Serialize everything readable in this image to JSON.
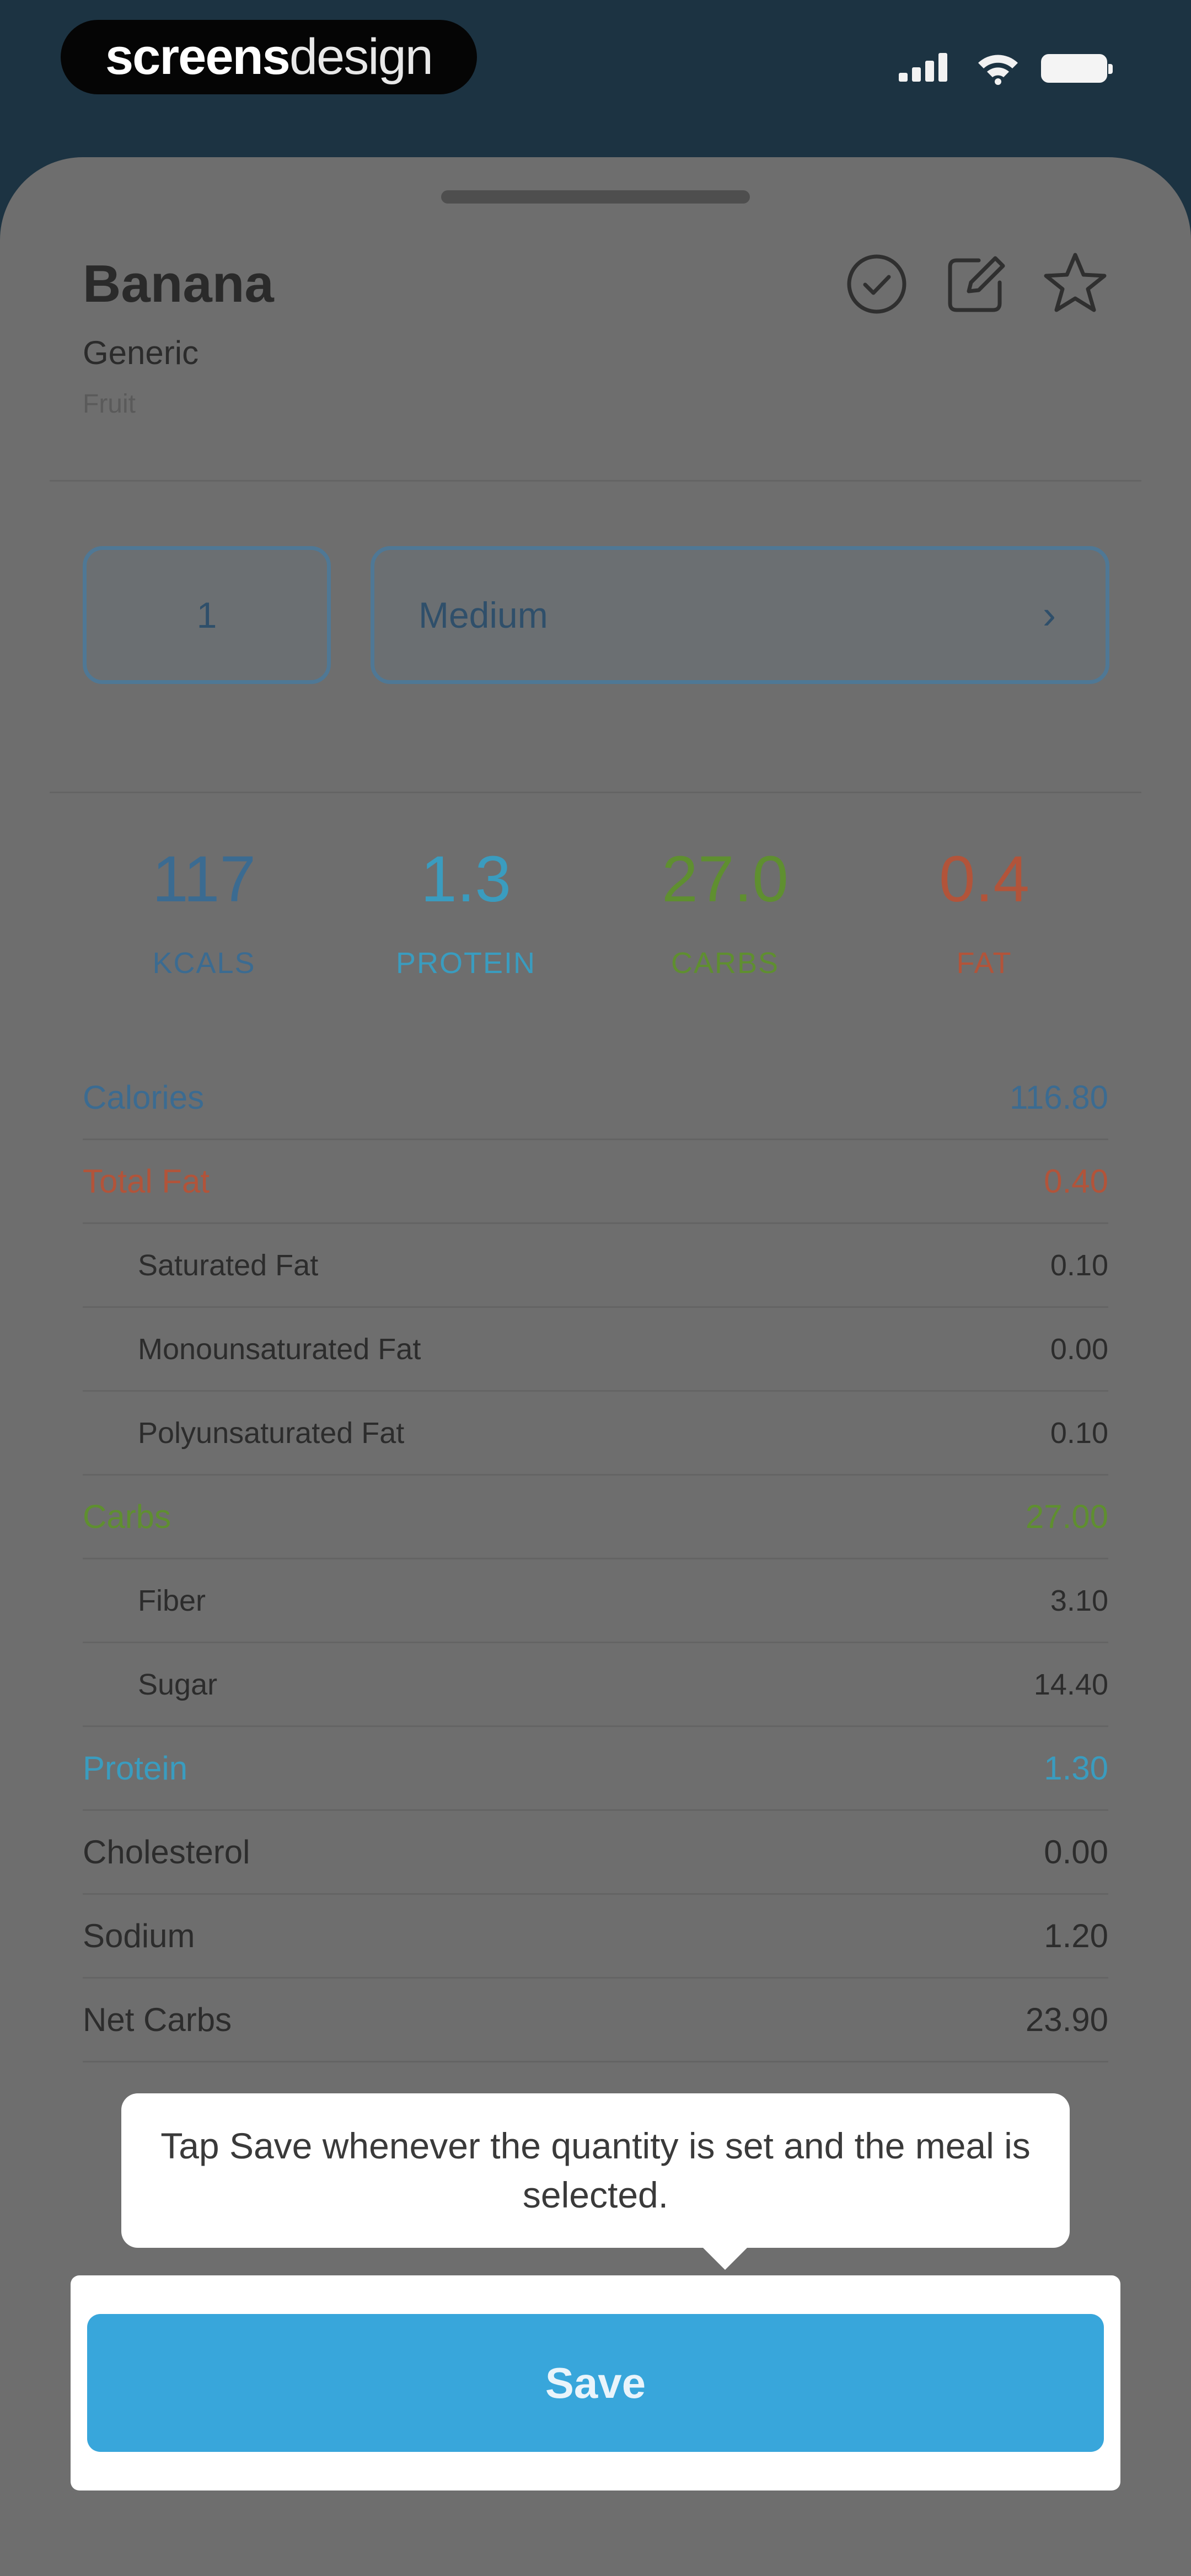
{
  "status_bar": {
    "brand_bold": "screens",
    "brand_light": "design"
  },
  "food": {
    "name": "Banana",
    "brand": "Generic",
    "category": "Fruit"
  },
  "actions": [
    "check-circle-icon",
    "edit-icon",
    "star-icon"
  ],
  "serving": {
    "quantity": "1",
    "size": "Medium",
    "chevron": "›"
  },
  "macros": [
    {
      "value": "117",
      "label": "KCALS",
      "color": "#3b6b91"
    },
    {
      "value": "1.3",
      "label": "PROTEIN",
      "color": "#3a9cbf"
    },
    {
      "value": "27.0",
      "label": "CARBS",
      "color": "#5f8f30"
    },
    {
      "value": "0.4",
      "label": "FAT",
      "color": "#b2543a"
    }
  ],
  "nutrients": [
    {
      "name": "Calories",
      "value": "116.80",
      "color": "#3b6b91",
      "sub": false
    },
    {
      "name": "Total Fat",
      "value": "0.40",
      "color": "#b2543a",
      "sub": false
    },
    {
      "name": "Saturated Fat",
      "value": "0.10",
      "color": "#2c2c2c",
      "sub": true
    },
    {
      "name": "Monounsaturated Fat",
      "value": "0.00",
      "color": "#2c2c2c",
      "sub": true
    },
    {
      "name": "Polyunsaturated Fat",
      "value": "0.10",
      "color": "#2c2c2c",
      "sub": true
    },
    {
      "name": "Carbs",
      "value": "27.00",
      "color": "#5f8f30",
      "sub": false
    },
    {
      "name": "Fiber",
      "value": "3.10",
      "color": "#2c2c2c",
      "sub": true
    },
    {
      "name": "Sugar",
      "value": "14.40",
      "color": "#2c2c2c",
      "sub": true
    },
    {
      "name": "Protein",
      "value": "1.30",
      "color": "#3a9cbf",
      "sub": false
    },
    {
      "name": "Cholesterol",
      "value": "0.00",
      "color": "#2c2c2c",
      "sub": false
    },
    {
      "name": "Sodium",
      "value": "1.20",
      "color": "#2c2c2c",
      "sub": false
    },
    {
      "name": "Net Carbs",
      "value": "23.90",
      "color": "#2c2c2c",
      "sub": false
    }
  ],
  "tooltip": "Tap Save whenever the quantity is set and the meal is selected.",
  "save_label": "Save"
}
